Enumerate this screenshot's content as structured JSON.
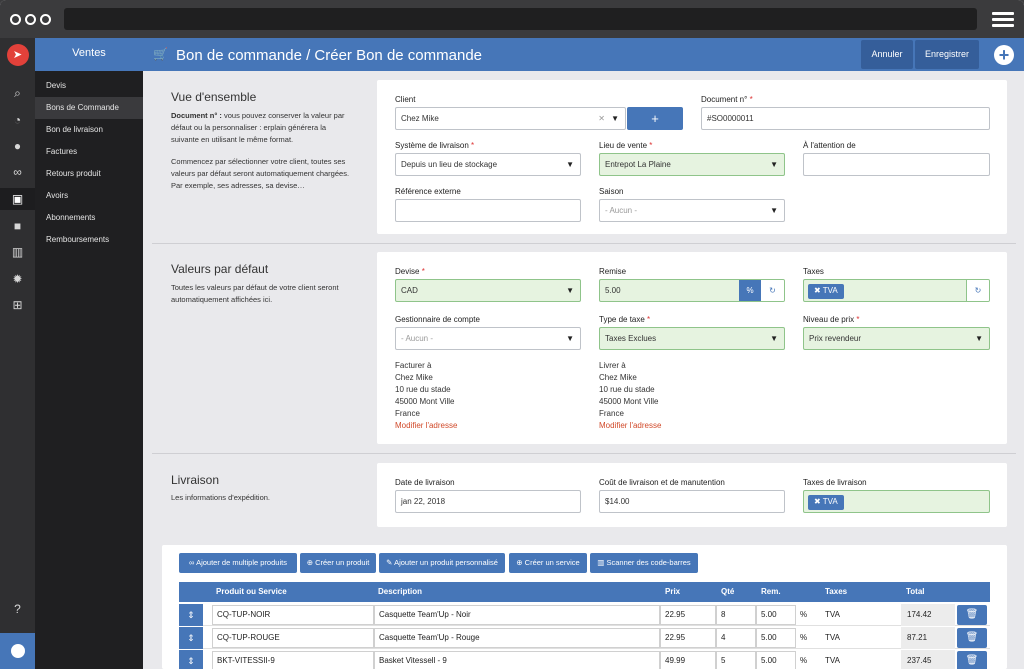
{
  "window": {
    "buttons": [
      "close",
      "minimize",
      "maximize"
    ]
  },
  "sidebar": {
    "title": "Ventes",
    "items": [
      {
        "label": "Devis"
      },
      {
        "label": "Bons de Commande"
      },
      {
        "label": "Bon de livraison"
      },
      {
        "label": "Factures"
      },
      {
        "label": "Retours produit"
      },
      {
        "label": "Avoirs"
      },
      {
        "label": "Abonnements"
      },
      {
        "label": "Remboursements"
      }
    ]
  },
  "rail_icons": [
    "search-icon",
    "dashboard-icon",
    "users-icon",
    "bikes-icon",
    "cart-icon",
    "truck-icon",
    "chart-icon",
    "gear-icon",
    "sitemap-icon",
    "help-icon",
    "user-icon"
  ],
  "header": {
    "title": "Bon de commande / Créer Bon de commande",
    "cancel": "Annuler",
    "save": "Enregistrer"
  },
  "overview": {
    "title": "Vue d'ensemble",
    "desc_bold": "Document n° :",
    "desc1": " vous pouvez conserver la valeur par défaut ou la personnaliser : erplain générera la suivante en utilisant le même format.",
    "desc2": "Commencez par sélectionner votre client, toutes ses valeurs par défaut seront automatiquement chargées. Par exemple, ses adresses, sa devise…",
    "client_label": "Client",
    "client_value": "Chez Mike",
    "doc_label": "Document n°",
    "doc_value": "#SO0000011",
    "shipping_label": "Système de livraison",
    "shipping_value": "Depuis un lieu de stockage",
    "sale_place_label": "Lieu de vente",
    "sale_place_value": "Entrepot La Plaine",
    "attention_label": "À l'attention de",
    "attention_value": "",
    "extref_label": "Référence externe",
    "extref_value": "",
    "season_label": "Saison",
    "season_value": "- Aucun -"
  },
  "defaults": {
    "title": "Valeurs par défaut",
    "desc": "Toutes les valeurs par défaut de votre client seront automatiquement affichées ici.",
    "currency_label": "Devise",
    "currency_value": "CAD",
    "discount_label": "Remise",
    "discount_value": "5.00",
    "discount_unit": "%",
    "taxes_label": "Taxes",
    "taxes_tag": "TVA",
    "manager_label": "Gestionnaire de compte",
    "manager_value": "- Aucun -",
    "taxtype_label": "Type de taxe",
    "taxtype_value": "Taxes Exclues",
    "pricelevel_label": "Niveau de prix",
    "pricelevel_value": "Prix revendeur",
    "bill_label": "Facturer à",
    "bill_lines": [
      "Chez Mike",
      "10 rue du stade",
      "45000 Mont Ville",
      "France"
    ],
    "ship_label": "Livrer à",
    "ship_lines": [
      "Chez Mike",
      "10 rue du stade",
      "45000 Mont Ville",
      "France"
    ],
    "edit_address": "Modifier l'adresse"
  },
  "delivery": {
    "title": "Livraison",
    "desc": "Les informations d'expédition.",
    "date_label": "Date de livraison",
    "date_value": "jan 22, 2018",
    "cost_label": "Coût de livraison et de manutention",
    "cost_value": "$14.00",
    "tax_label": "Taxes de livraison",
    "tax_tag": "TVA"
  },
  "toolbar": {
    "buttons": [
      {
        "label": "Ajouter de multiple produits"
      },
      {
        "label": "Créer un produit"
      },
      {
        "label": "Ajouter un produit personnalisé"
      },
      {
        "label": "Créer un service"
      },
      {
        "label": "Scanner des code-barres"
      }
    ]
  },
  "table": {
    "headers": [
      "Produit ou Service",
      "Description",
      "Prix",
      "Qté",
      "Rem.",
      "Taxes",
      "Total"
    ],
    "rows": [
      {
        "code": "CQ-TUP-NOIR",
        "desc": "Casquette Team'Up - Noir",
        "price": "22.95",
        "qty": "8",
        "disc": "5.00",
        "unit": "%",
        "tax": "TVA",
        "total": "174.42"
      },
      {
        "code": "CQ-TUP-ROUGE",
        "desc": "Casquette Team'Up - Rouge",
        "price": "22.95",
        "qty": "4",
        "disc": "5.00",
        "unit": "%",
        "tax": "TVA",
        "total": "87.21"
      },
      {
        "code": "BKT-VITESSII-9",
        "desc": "Basket Vitessell - 9",
        "price": "49.99",
        "qty": "5",
        "disc": "5.00",
        "unit": "%",
        "tax": "TVA",
        "total": "237.45"
      }
    ]
  },
  "colors": {
    "primary": "#4676b8",
    "green_field": "#e6f3e0",
    "link": "#d14a2a"
  }
}
